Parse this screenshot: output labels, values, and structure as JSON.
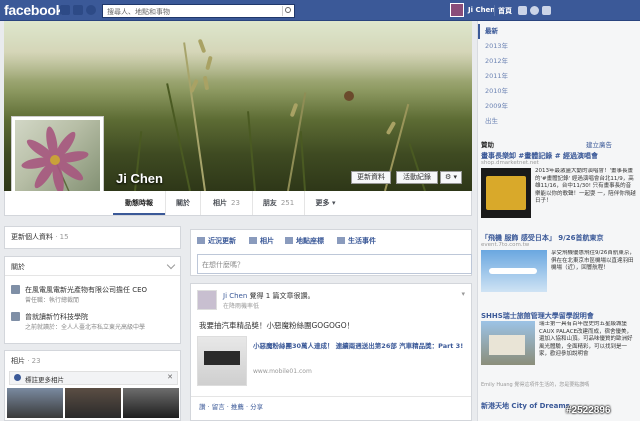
{
  "topbar": {
    "logo": "facebook",
    "search_placeholder": "搜尋人、地點和事物",
    "user_name": "Ji Chen",
    "home_label": "首頁"
  },
  "profile": {
    "name": "Ji Chen",
    "update_info_button": "更新資料",
    "activity_log_button": "活動紀錄",
    "settings_button": "⚙ ▾"
  },
  "tabs": [
    {
      "label": "動態時報",
      "count": ""
    },
    {
      "label": "關於",
      "count": ""
    },
    {
      "label": "相片",
      "count": "23"
    },
    {
      "label": "朋友",
      "count": "251"
    },
    {
      "label": "更多 ▾",
      "count": ""
    }
  ],
  "left": {
    "update_info_label": "更新個人資料",
    "update_info_count": "· 15",
    "about_label": "關於",
    "work_title": "在風電風電新光產物有限公司擔任 CEO",
    "work_sub": "曾任職：執行總裁閒",
    "edu_title": "曾就讀新竹科技學院",
    "edu_sub": "之前就讀於：全人人臺北市私立東光高級中學",
    "photos_label": "相片",
    "photos_count": "· 23",
    "photos_tip": "標註更多相片"
  },
  "composer": {
    "tabs": [
      "近況更新",
      "相片",
      "地點座標",
      "生活事件"
    ],
    "placeholder": "在想什麼嗎？"
  },
  "post": {
    "author": "Ji Chen",
    "action": "覺得 1 篇文章很讚。",
    "sub": "在降雨機率低",
    "text": "我要抽汽車精品獎！小惡魔粉絲團GOGOGO！",
    "link_title": "小惡魔粉絲團30萬人達成！ 連續兩週送出第26部 汽車精品獎：Part 3!",
    "link_url": "www.mobile01.com",
    "actions": "讚 · 留言 · 推薦 · 分享"
  },
  "sidebar": {
    "years": [
      "最新",
      "2013年",
      "2012年",
      "2011年",
      "2010年",
      "2009年",
      "出生"
    ],
    "sponsored_label": "贊助",
    "create_ad": "建立廣告",
    "ads": [
      {
        "title": "畫事長樂卸 #畫體記錄 # 經過演唱會",
        "url": "shop.dmarketnet.net",
        "body": "2013年最激盪大動的演唱會！'畫事長畫的'#畫體記錄' 經過演唱會台北11/9，高雄11/16，台中11/30! 只有畫事長的音樂能以你的歌聲！一起耍 一，陪伴你飛越日子！"
      },
      {
        "title": "「飛機 服飾 感受日本」 9/26首航東京",
        "url": "event.7to.com.tw",
        "body": "享受飛機優惠飛往9/26首航東京，俱在在北東京市區機場以直達羽田機場（近），回響航程！"
      },
      {
        "title": "SHHS瑞士旅館管理大學留學說明會",
        "url": "",
        "body": "瑞士第一具有百年歷史的五星級城堡CAUX PALACE改建而成，宿舍優美，還加入協和山頂。可品味優質的歐洲好風光體驗，全面精彩，可以找到是一家，歡迎參加說明會"
      },
      {
        "title": "新港天地 City of Dreams",
        "url": "",
        "body": ""
      }
    ],
    "liked_by": "Emily Huang 覺得這項件生活的，您是要點讚嗎"
  },
  "watermark": "#2522896"
}
